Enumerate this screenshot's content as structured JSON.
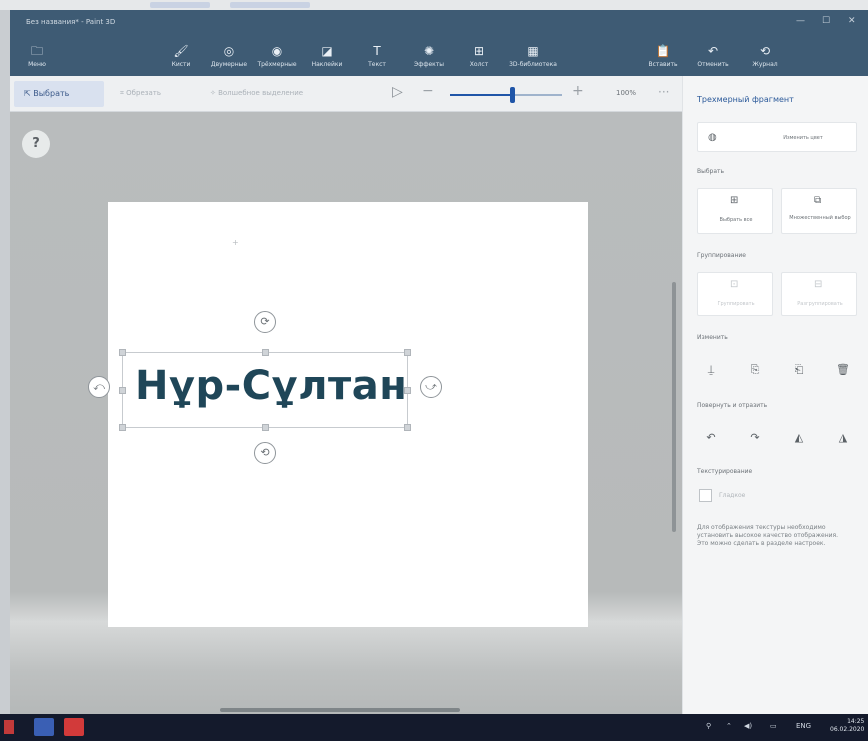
{
  "window": {
    "title": "Без названия* - Paint 3D",
    "minimize": "—",
    "maximize": "☐",
    "close": "✕"
  },
  "commands": {
    "menu": {
      "label": "Меню",
      "icon": "folder-icon",
      "glyph": "🗀"
    },
    "brushes": {
      "label": "Кисти",
      "icon": "brush-icon",
      "glyph": "🖌"
    },
    "shapes2d": {
      "label": "Двумерные",
      "icon": "shapes-2d-icon",
      "glyph": "◎"
    },
    "shapes3d": {
      "label": "Трёхмерные",
      "icon": "shapes-3d-icon",
      "glyph": "◉"
    },
    "stickers": {
      "label": "Наклейки",
      "icon": "sticker-icon",
      "glyph": "◪"
    },
    "text": {
      "label": "Текст",
      "icon": "text-icon",
      "glyph": "T"
    },
    "effects": {
      "label": "Эффекты",
      "icon": "effects-icon",
      "glyph": "✺"
    },
    "canvas": {
      "label": "Холст",
      "icon": "canvas-icon",
      "glyph": "⊞"
    },
    "library": {
      "label": "3D-библиотека",
      "icon": "library-icon",
      "glyph": "▦"
    },
    "paste": {
      "label": "Вставить",
      "icon": "paste-icon",
      "glyph": "📋"
    },
    "undo": {
      "label": "Отменить",
      "icon": "undo-icon",
      "glyph": "↶"
    },
    "history": {
      "label": "Журнал",
      "icon": "history-icon",
      "glyph": "⟲"
    }
  },
  "toolbar": {
    "select_label": "Выбрать",
    "crop_label": "Обрезать",
    "magic_label": "Волшебное выделение",
    "zoom_value": "100%",
    "zoom_level": 0.55,
    "play_icon": "play-icon",
    "more": "···"
  },
  "canvas": {
    "text": "Нұр-Сұлтан"
  },
  "panel": {
    "title": "Трехмерный фрагмент",
    "edit_color": "Изменить цвет",
    "section_select": "Выбрать",
    "select_all": "Выбрать все",
    "multi_select": "Множественный выбор",
    "section_group": "Группирование",
    "group": "Группировать",
    "ungroup": "Разгруппировать",
    "section_flip": "Изменить",
    "section_rotate": "Повернуть и отразить",
    "section_texture": "Текстурирование",
    "smooth": "Гладкое",
    "description": "Для отображения текстуры необходимо установить высокое качество отображения. Это можно сделать в разделе настроек."
  },
  "taskbar": {
    "time": "14:25",
    "date": "06.02.2020",
    "lang": "ENG"
  },
  "colors": {
    "title_bar": "#3e5b74",
    "accent": "#1f55a8",
    "text_art": "#1f4658",
    "taskbar": "#141a2c"
  }
}
